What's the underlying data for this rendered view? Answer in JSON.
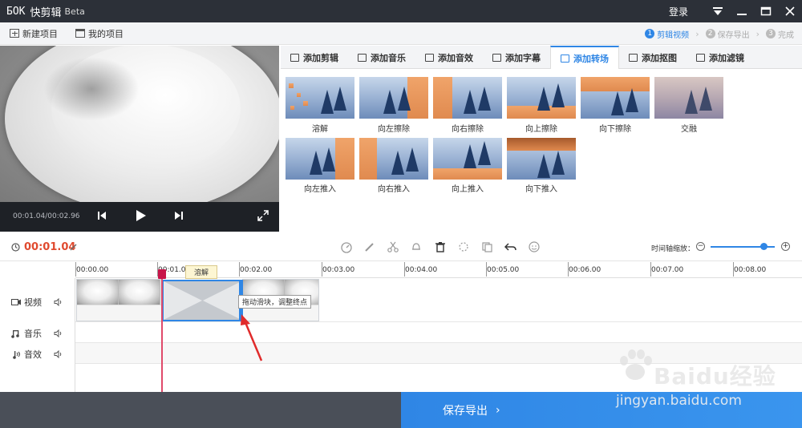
{
  "app": {
    "logo_mark": "ƂOK",
    "title": "快剪辑",
    "beta": "Beta",
    "login": "登录"
  },
  "toolbar": {
    "new_project": "新建项目",
    "my_projects": "我的项目",
    "steps": [
      {
        "num": "1",
        "label": "剪辑视频"
      },
      {
        "num": "2",
        "label": "保存导出"
      },
      {
        "num": "3",
        "label": "完成"
      }
    ]
  },
  "preview": {
    "time": "00:01.04/00:02.96"
  },
  "tabs": [
    {
      "label": "添加剪辑"
    },
    {
      "label": "添加音乐"
    },
    {
      "label": "添加音效"
    },
    {
      "label": "添加字幕"
    },
    {
      "label": "添加转场"
    },
    {
      "label": "添加抠图"
    },
    {
      "label": "添加滤镜"
    }
  ],
  "transitions": [
    {
      "label": "溶解"
    },
    {
      "label": "向左擦除"
    },
    {
      "label": "向右擦除"
    },
    {
      "label": "向上擦除"
    },
    {
      "label": "向下擦除"
    },
    {
      "label": "交融"
    },
    {
      "label": "向左推入"
    },
    {
      "label": "向右推入"
    },
    {
      "label": "向上推入"
    },
    {
      "label": "向下推入"
    }
  ],
  "timeline": {
    "current_time": "00:01.04",
    "zoom_label": "时间轴缩放：",
    "zoom_level": 0.83,
    "ruler": [
      "00:00.00",
      "00:01.00",
      "00:02.00",
      "00:03.00",
      "00:04.00",
      "00:05.00",
      "00:06.00",
      "00:07.00",
      "00:08.00"
    ],
    "tracks": [
      {
        "label": "视频"
      },
      {
        "label": "音乐"
      },
      {
        "label": "音效"
      }
    ],
    "transition_tag": "溶解",
    "hint": "拖动滑块，调整终点"
  },
  "bottom": {
    "save_export": "保存导出"
  },
  "watermark": {
    "brand": "Baidu经验",
    "url": "jingyan.baidu.com"
  },
  "colors": {
    "accent": "#2f86e5",
    "title_bar": "#2c3038",
    "playhead": "#e04a6a",
    "time_red": "#e04a2f"
  }
}
